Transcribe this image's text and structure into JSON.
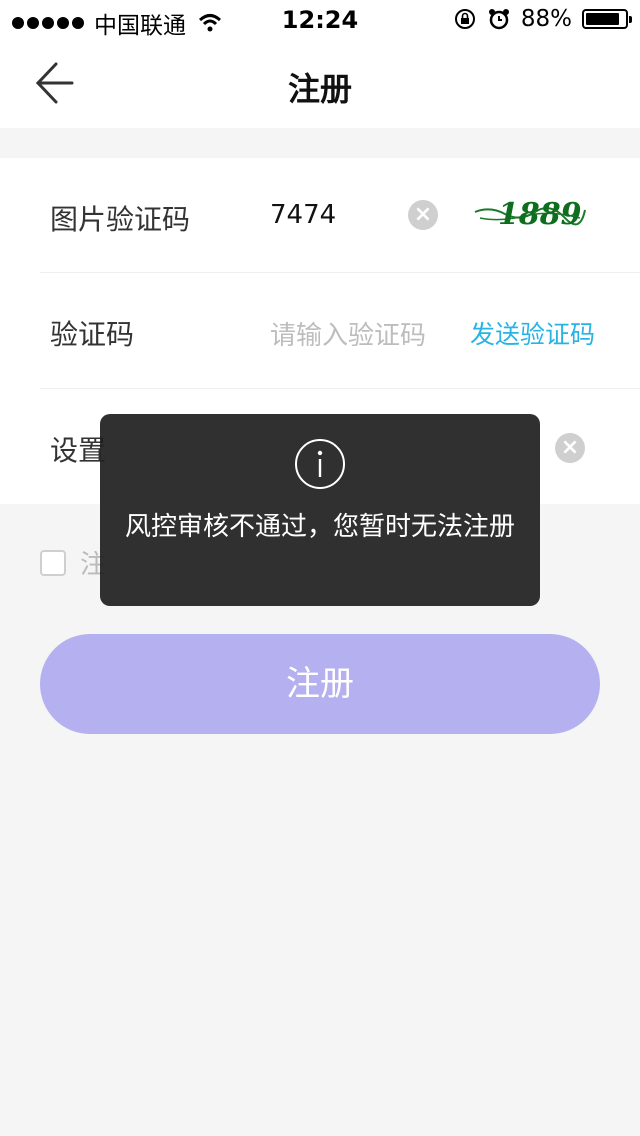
{
  "status_bar": {
    "carrier": "中国联通",
    "time": "12:24",
    "battery": "88%",
    "battery_level": 0.88,
    "icons": [
      "signal-dots-icon",
      "wifi-icon",
      "rotation-lock-icon",
      "alarm-icon",
      "battery-icon"
    ]
  },
  "nav": {
    "title": "注册",
    "back_icon": "arrow-left-icon"
  },
  "form": {
    "captcha_row": {
      "label": "图片验证码",
      "value": "7474",
      "captcha_text": "1889"
    },
    "code_row": {
      "label": "验证码",
      "placeholder": "请输入验证码",
      "send_label": "发送验证码"
    },
    "password_row": {
      "label": "设置"
    }
  },
  "agreement": {
    "label": "注"
  },
  "register_button": {
    "label": "注册"
  },
  "toast": {
    "icon": "info-icon",
    "message": "风控审核不通过，您暂时无法注册"
  },
  "colors": {
    "accent": "#27b4e4",
    "register_button": "#b5b0f0",
    "toast_bg": "#1e1e1e",
    "background": "#f5f5f5"
  }
}
